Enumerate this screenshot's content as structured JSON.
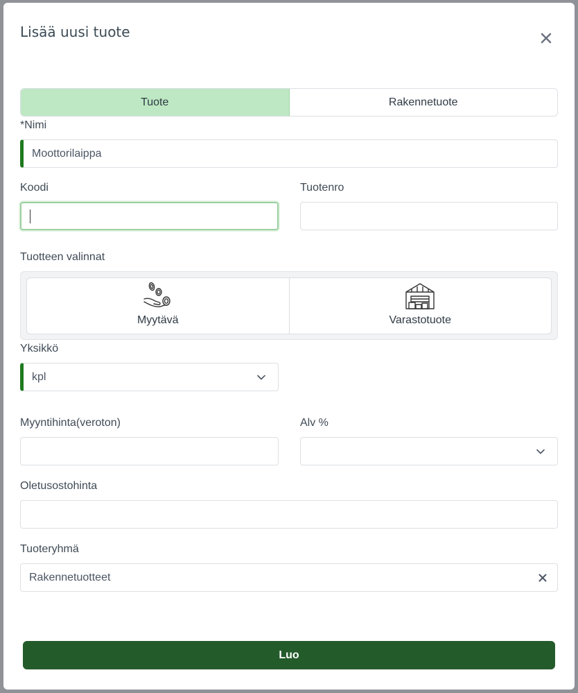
{
  "dialog": {
    "title": "Lisää uusi tuote",
    "close_icon": "close-icon"
  },
  "type_toggle": {
    "options": [
      "Tuote",
      "Rakennetuote"
    ],
    "selected": "Tuote"
  },
  "fields": {
    "name": {
      "label": "*Nimi",
      "value": "Moottorilaippa"
    },
    "code": {
      "label": "Koodi",
      "value": ""
    },
    "product_no": {
      "label": "Tuotenro",
      "value": ""
    },
    "unit": {
      "label": "Yksikkö",
      "value": "kpl"
    },
    "sales_price": {
      "label": "Myyntihinta(veroton)",
      "value": ""
    },
    "vat": {
      "label": "Alv %",
      "value": ""
    },
    "default_purchase_price": {
      "label": "Oletusostohinta",
      "value": ""
    },
    "product_group": {
      "label": "Tuoteryhmä",
      "value": "Rakennetuotteet"
    }
  },
  "product_options": {
    "label": "Tuotteen valinnat",
    "items": [
      {
        "label": "Myytävä",
        "icon": "hand-coins-icon"
      },
      {
        "label": "Varastotuote",
        "icon": "warehouse-icon"
      }
    ]
  },
  "submit": {
    "label": "Luo"
  },
  "colors": {
    "accent_green": "#1f7a1f",
    "selected_tab": "#bde8c3",
    "submit_bg": "#245b2b"
  }
}
